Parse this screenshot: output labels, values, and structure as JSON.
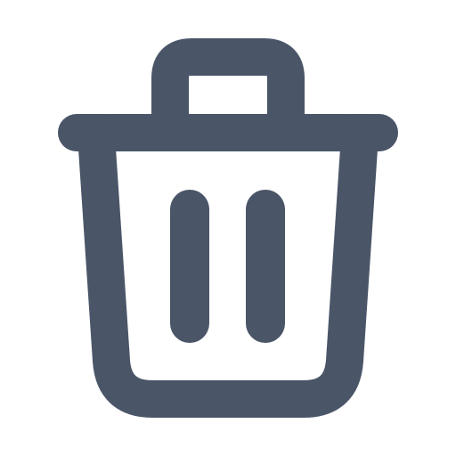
{
  "icon": {
    "name": "trash-icon",
    "color": "#4a5568",
    "background": "#ffffff"
  }
}
